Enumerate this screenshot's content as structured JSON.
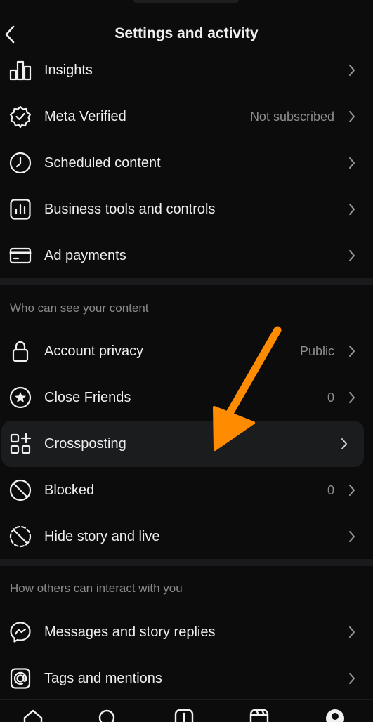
{
  "header": {
    "title": "Settings and activity",
    "back_icon": "chevron-left-icon"
  },
  "rows": {
    "insights": {
      "label": "Insights",
      "icon": "bar-chart-icon"
    },
    "meta_verified": {
      "label": "Meta Verified",
      "value": "Not subscribed",
      "icon": "verified-badge-icon"
    },
    "scheduled": {
      "label": "Scheduled content",
      "icon": "clock-icon"
    },
    "business": {
      "label": "Business tools and controls",
      "icon": "chart-box-icon"
    },
    "ad_payments": {
      "label": "Ad payments",
      "icon": "credit-card-icon"
    },
    "account_privacy": {
      "label": "Account privacy",
      "value": "Public",
      "icon": "lock-icon"
    },
    "close_friends": {
      "label": "Close Friends",
      "value": "0",
      "icon": "star-circle-icon"
    },
    "crossposting": {
      "label": "Crossposting",
      "icon": "grid-plus-icon"
    },
    "blocked": {
      "label": "Blocked",
      "value": "0",
      "icon": "blocked-icon"
    },
    "hide_story": {
      "label": "Hide story and live",
      "icon": "hide-story-icon"
    },
    "messages": {
      "label": "Messages and story replies",
      "icon": "messenger-icon"
    },
    "tags": {
      "label": "Tags and mentions",
      "icon": "at-sign-icon"
    }
  },
  "sections": {
    "visibility": "Who can see your content",
    "interaction": "How others can interact with you"
  },
  "bottom_nav": [
    "home-icon",
    "search-icon",
    "create-icon",
    "reels-icon",
    "profile-icon"
  ],
  "colors": {
    "background": "#0c0c0d",
    "highlight": "#1b1c1e",
    "annotation_arrow": "#ff8c00",
    "secondary_text": "#8e8e8e"
  }
}
